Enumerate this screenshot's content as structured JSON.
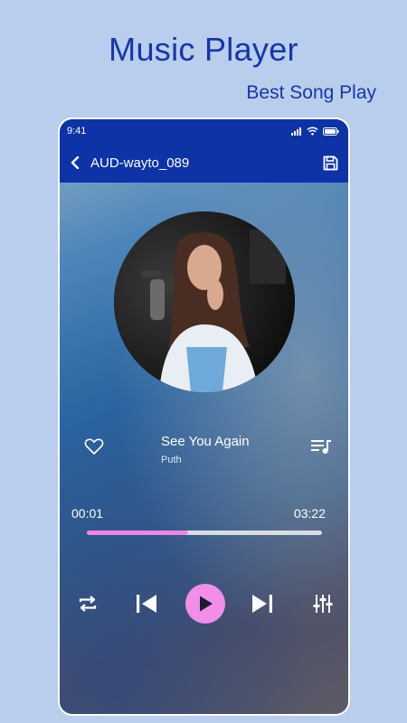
{
  "promo": {
    "title": "Music Player",
    "subtitle": "Best Song Play"
  },
  "statusbar": {
    "time": "9:41"
  },
  "appbar": {
    "file_name": "AUD-wayto_089"
  },
  "now_playing": {
    "title": "See You Again",
    "artist": "Puth",
    "current_time": "00:01",
    "total_time": "03:22",
    "progress": 0.43
  },
  "icons": {
    "back": "chevron-left-icon",
    "save": "save-icon",
    "favorite": "heart-icon",
    "queue": "playlist-icon",
    "repeat": "repeat-icon",
    "previous": "skip-previous-icon",
    "play": "play-icon",
    "next": "skip-next-icon",
    "equalizer": "equalizer-icon"
  },
  "colors": {
    "brand_blue": "#0d33a6",
    "promo_text": "#1736a8",
    "page_bg": "#b9cdec",
    "accent_pink": "#f08ee8"
  }
}
